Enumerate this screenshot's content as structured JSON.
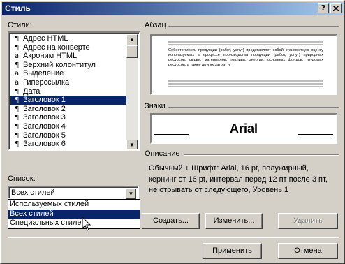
{
  "window": {
    "title": "Стиль",
    "help_btn": "?",
    "close_btn": "X"
  },
  "styles_list": {
    "label": "Стили:",
    "items": [
      {
        "glyph": "¶",
        "label": "Адрес HTML",
        "selected": false
      },
      {
        "glyph": "¶",
        "label": "Адрес на конверте",
        "selected": false
      },
      {
        "glyph": "a",
        "label": "Акроним HTML",
        "selected": false
      },
      {
        "glyph": "¶",
        "label": "Верхний колонтитул",
        "selected": false
      },
      {
        "glyph": "a",
        "label": "Выделение",
        "selected": false
      },
      {
        "glyph": "a",
        "label": "Гиперссылка",
        "selected": false
      },
      {
        "glyph": "¶",
        "label": "Дата",
        "selected": false
      },
      {
        "glyph": "¶",
        "label": "Заголовок 1",
        "selected": true
      },
      {
        "glyph": "¶",
        "label": "Заголовок 2",
        "selected": false
      },
      {
        "glyph": "¶",
        "label": "Заголовок 3",
        "selected": false
      },
      {
        "glyph": "¶",
        "label": "Заголовок 4",
        "selected": false
      },
      {
        "glyph": "¶",
        "label": "Заголовок 5",
        "selected": false
      },
      {
        "glyph": "¶",
        "label": "Заголовок 6",
        "selected": false
      }
    ]
  },
  "paragraph": {
    "label": "Абзац",
    "sample_text": "Себестоимость продукции (работ, услуг) представляет собой стоимостную оценку используемых в процессе производства продукции (работ, услуг) природных ресурсов, сырья, материалов, топлива, энергии, основных фондов, трудовых ресурсов, а также других затрат н"
  },
  "characters": {
    "label": "Знаки",
    "sample": "Arial"
  },
  "description": {
    "label": "Описание",
    "text": "Обычный + Шрифт: Arial, 16 pt, полужирный, кернинг от 16 pt, интервал перед 12 пт  после 3 пт, не отрывать от следующего, Уровень 1"
  },
  "list_filter": {
    "label": "Список:",
    "value": "Всех стилей",
    "options": [
      {
        "label": "Используемых стилей",
        "selected": false
      },
      {
        "label": "Всех стилей",
        "selected": true
      },
      {
        "label": "Специальных стилей",
        "selected": false
      }
    ]
  },
  "buttons": {
    "create": "Создать...",
    "modify": "Изменить...",
    "delete": "Удалить",
    "apply": "Применить",
    "cancel": "Отмена"
  },
  "colors": {
    "selection": "#0a246a",
    "face": "#d4d0c8",
    "title_start": "#0a246a",
    "title_end": "#a6caf0"
  }
}
